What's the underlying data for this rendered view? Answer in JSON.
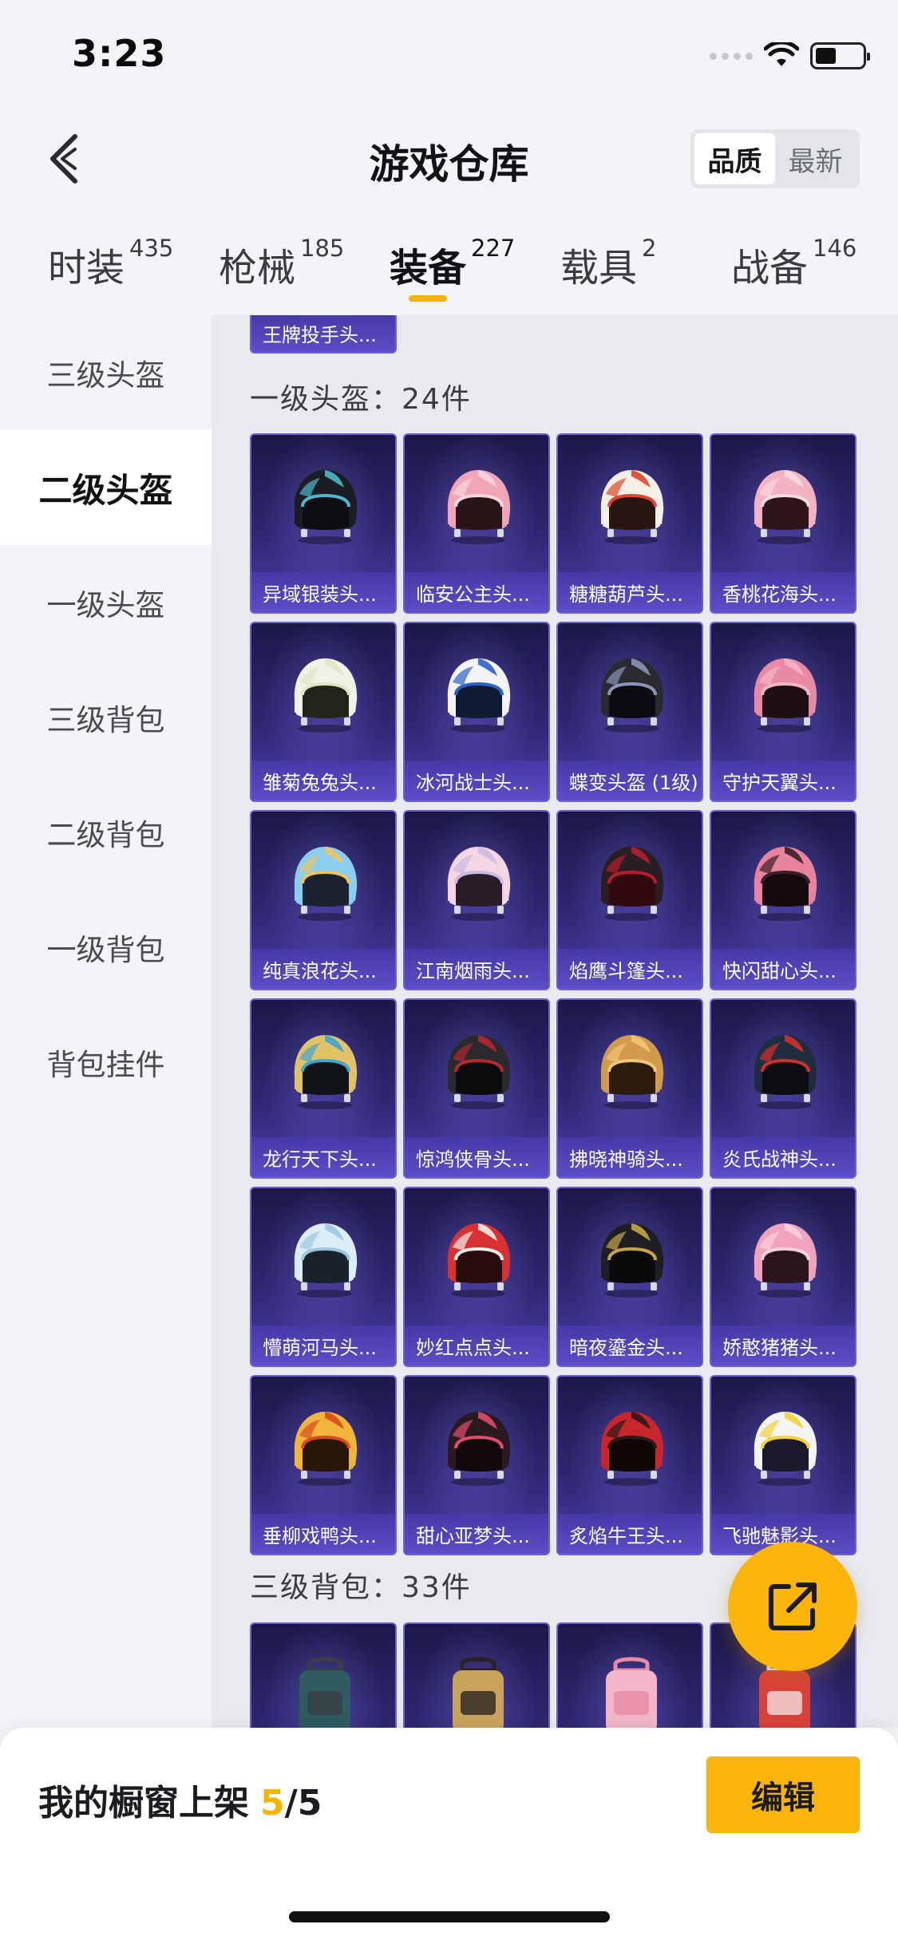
{
  "status_bar": {
    "time": "3:23",
    "battery_level": 0.44
  },
  "header": {
    "title": "游戏仓库",
    "sort_options": [
      "品质",
      "最新"
    ],
    "sort_selected": "品质"
  },
  "category_tabs": [
    {
      "label": "时装",
      "count": "435"
    },
    {
      "label": "枪械",
      "count": "185"
    },
    {
      "label": "装备",
      "count": "227",
      "active": true
    },
    {
      "label": "载具",
      "count": "2"
    },
    {
      "label": "战备",
      "count": "146"
    }
  ],
  "sidebar": {
    "items": [
      {
        "label": "三级头盔"
      },
      {
        "label": "二级头盔",
        "active": true
      },
      {
        "label": "一级头盔"
      },
      {
        "label": "三级背包"
      },
      {
        "label": "二级背包"
      },
      {
        "label": "一级背包"
      },
      {
        "label": "背包挂件"
      }
    ]
  },
  "main": {
    "partial_top_item": "王牌投手头...",
    "section_helmet1": {
      "title": "一级头盔：24件"
    },
    "helmets": [
      {
        "name": "异域银装头...",
        "c1": "#1b1d22",
        "c2": "#4fb7c9",
        "visor": "#0d0e12"
      },
      {
        "name": "临安公主头...",
        "c1": "#f2a4b7",
        "c2": "#f6d6de",
        "visor": "#2a1418"
      },
      {
        "name": "糖糖葫芦头...",
        "c1": "#f3efe6",
        "c2": "#d9482f",
        "visor": "#2b1510"
      },
      {
        "name": "香桃花海头...",
        "c1": "#f4b3c2",
        "c2": "#f7d9e0",
        "visor": "#2d1519"
      },
      {
        "name": "雏菊兔兔头...",
        "c1": "#f1f1e6",
        "c2": "#dfe7c2",
        "visor": "#23251b"
      },
      {
        "name": "冰河战士头...",
        "c1": "#f3f3f6",
        "c2": "#2c62c8",
        "visor": "#0f1a33"
      },
      {
        "name": "蝶变头盔 (1级)",
        "c1": "#2a2a30",
        "c2": "#8b95b8",
        "visor": "#0b0b10"
      },
      {
        "name": "守护天翼头...",
        "c1": "#e889a5",
        "c2": "#f2b6c7",
        "visor": "#1e0f13"
      },
      {
        "name": "纯真浪花头...",
        "c1": "#8bcff0",
        "c2": "#eac36a",
        "visor": "#1a242e"
      },
      {
        "name": "江南烟雨头...",
        "c1": "#f3d6e2",
        "c2": "#c9bbe6",
        "visor": "#2a1d28"
      },
      {
        "name": "焰鹰斗篷头...",
        "c1": "#2a1e22",
        "c2": "#b51e2e",
        "visor": "#300a0e"
      },
      {
        "name": "快闪甜心头...",
        "c1": "#e9839b",
        "c2": "#3a1e2a",
        "visor": "#160a0d"
      },
      {
        "name": "龙行天下头...",
        "c1": "#e1c266",
        "c2": "#41a5cf",
        "visor": "#0e1418"
      },
      {
        "name": "惊鸿侠骨头...",
        "c1": "#2a2a2e",
        "c2": "#b4282f",
        "visor": "#0c0c0f"
      },
      {
        "name": "拂晓神骑头...",
        "c1": "#d29b4b",
        "c2": "#f0c67a",
        "visor": "#2b1b0c"
      },
      {
        "name": "炎氏战神头...",
        "c1": "#1f2d3f",
        "c2": "#d22f2f",
        "visor": "#0c0e12"
      },
      {
        "name": "懵萌河马头...",
        "c1": "#dbeef8",
        "c2": "#9cc6e3",
        "visor": "#1a2128"
      },
      {
        "name": "妙红点点头...",
        "c1": "#d93131",
        "c2": "#f7f0ea",
        "visor": "#2b0c0c"
      },
      {
        "name": "暗夜鎏金头...",
        "c1": "#1f1f23",
        "c2": "#c9a548",
        "visor": "#0a0a0c"
      },
      {
        "name": "娇憨猪猪头...",
        "c1": "#f1a3bd",
        "c2": "#f7d1dd",
        "visor": "#2b141b"
      },
      {
        "name": "垂柳戏鸭头...",
        "c1": "#f1b53b",
        "c2": "#d84b1d",
        "visor": "#2a160a"
      },
      {
        "name": "甜心亚梦头...",
        "c1": "#2a1a20",
        "c2": "#e04d6c",
        "visor": "#12080a"
      },
      {
        "name": "炙焰牛王头...",
        "c1": "#c8262c",
        "c2": "#2a1a1a",
        "visor": "#120707"
      },
      {
        "name": "飞驰魅影头...",
        "c1": "#f4f4f6",
        "c2": "#f2d23a",
        "visor": "#1b1a2c"
      }
    ],
    "section_backpack3": {
      "title": "三级背包：33件"
    },
    "backpacks": [
      {
        "c1": "#2f5b62",
        "c2": "#3a3f45"
      },
      {
        "c1": "#c9a35b",
        "c2": "#2a2420"
      },
      {
        "c1": "#f2b6c8",
        "c2": "#e88aa6"
      },
      {
        "c1": "#d9423a",
        "c2": "#f2dede"
      }
    ]
  },
  "showcase": {
    "label": "我的橱窗上架",
    "current": "5",
    "separator": "/",
    "total": "5"
  },
  "edit_button": {
    "label": "编辑"
  },
  "colors": {
    "accent": "#fbb40a",
    "card_bg": "#2d2770",
    "card_border": "#6e5fd6"
  }
}
